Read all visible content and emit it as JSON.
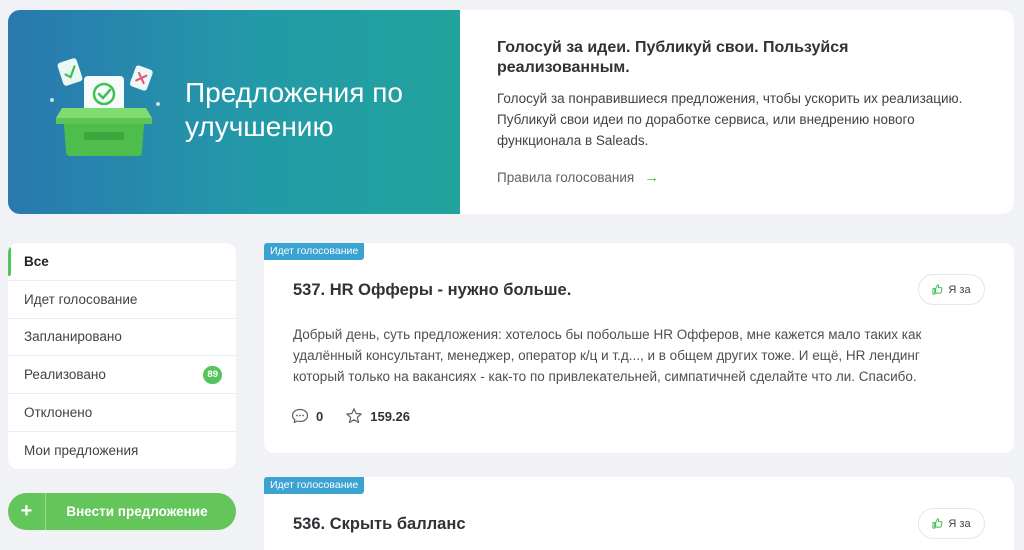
{
  "banner": {
    "title": "Предложения по улучшению",
    "heading": "Голосуй за идеи. Публикуй свои. Пользуйся реализованным.",
    "text": "Голосуй за понравившиеся предложения, чтобы ускорить их реализацию. Публикуй свои идеи по доработке сервиса, или внедрению нового функционала в Saleads.",
    "rules_link": "Правила голосования",
    "rules_arrow": "→"
  },
  "sidebar": {
    "items": [
      {
        "label": "Все",
        "active": true
      },
      {
        "label": "Идет голосование"
      },
      {
        "label": "Запланировано"
      },
      {
        "label": "Реализовано",
        "badge": "89"
      },
      {
        "label": "Отклонено"
      },
      {
        "label": "Мои предложения"
      }
    ],
    "add_button_icon": "+",
    "add_button_label": "Внести предложение"
  },
  "cards": [
    {
      "status": "Идет голосование",
      "title": "537. HR Офферы - нужно больше.",
      "vote_label": "Я за",
      "text": "Добрый день, суть предложения: хотелось бы побольше HR Офферов, мне кажется мало таких как удалённый консультант, менеджер, оператор к/ц и т.д..., и в общем других тоже. И ещё, HR лендинг который только на вакансиях - как-то по привлекательней, симпатичней сделайте что ли. Спасибо.",
      "comments": "0",
      "rating": "159.26"
    },
    {
      "status": "Идет голосование",
      "title": "536. Скрыть балланс",
      "vote_label": "Я за"
    }
  ],
  "colors": {
    "accent_green": "#55c45e",
    "status_blue": "#3aa3d1",
    "banner_gradient_start": "#2a78b0",
    "banner_gradient_end": "#22a39c"
  },
  "icons": {
    "ballot_box": "ballot-box-illustration",
    "thumb": "thumbs-up-icon",
    "comment": "comment-icon",
    "star": "star-icon",
    "arrow": "arrow-right-icon"
  }
}
